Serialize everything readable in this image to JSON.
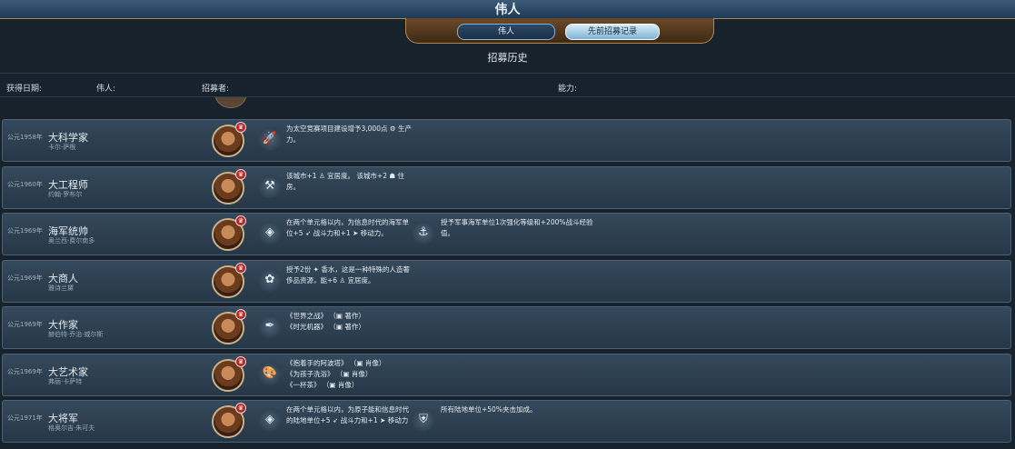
{
  "window": {
    "title": "伟人"
  },
  "tabs": [
    {
      "label": "伟人",
      "active": false
    },
    {
      "label": "先前招募记录",
      "active": true
    }
  ],
  "subtitle": "招募历史",
  "columns": {
    "date": "获得日期:",
    "person": "伟人:",
    "recruiter": "招募者:",
    "ability": "能力:"
  },
  "colors": {
    "accent_gold": "#a78b4e",
    "panel": "#2e4254",
    "badge": "#b22a2a"
  },
  "records": [
    {
      "date": "公元1958年",
      "type": "大科学家",
      "name": "卡尔·萨根",
      "abilities": [
        {
          "icon": "rocket-icon",
          "text": "为太空竞赛项目建设增予3,000点 ⚙ 生产力。"
        }
      ]
    },
    {
      "date": "公元1960年",
      "type": "大工程师",
      "name": "约翰·罗布尔",
      "abilities": [
        {
          "icon": "hammer-wrench-icon",
          "text": "该城市+1 ♙ 宜居度。 该城市+2 ☗ 住房。"
        }
      ]
    },
    {
      "date": "公元1969年",
      "type": "海军统帅",
      "name": "奥兰西·费尔南多",
      "abilities": [
        {
          "icon": "compass-icon",
          "text": "在两个单元格以内，为信息时代的海军单位+5 ➶ 战斗力和+1 ➤ 移动力。"
        },
        {
          "icon": "anchor-icon",
          "text": "授予军事海军单位1次强化等级和+200%战斗经验值。"
        }
      ]
    },
    {
      "date": "公元1969年",
      "type": "大商人",
      "name": "雅诗兰黛",
      "abilities": [
        {
          "icon": "perfume-icon",
          "text": "授予2份 ✦ 香水，这是一种特殊的人造奢侈品资源，能+6 ♙ 宜居度。"
        }
      ]
    },
    {
      "date": "公元1969年",
      "type": "大作家",
      "name": "赫伯特·乔治·威尔斯",
      "abilities": [
        {
          "icon": "quill-icon",
          "text": "《世界之战》 （▣ 著作）\n《时光机器》 （▣ 著作）"
        }
      ]
    },
    {
      "date": "公元1969年",
      "type": "大艺术家",
      "name": "弗丽·卡萨特",
      "abilities": [
        {
          "icon": "palette-icon",
          "text": "《抱着手的阿波塔》 （▣ 肖像）\n《为孩子洗浴》 （▣ 肖像）\n《一杯茶》 （▣ 肖像）"
        }
      ]
    },
    {
      "date": "公元1971年",
      "type": "大将军",
      "name": "格奥尔吉·朱可夫",
      "abilities": [
        {
          "icon": "compass-icon",
          "text": "在两个单元格以内，为原子能和信息时代的陆地单位+5 ➶ 战斗力和+1 ➤ 移动力"
        },
        {
          "icon": "shield-banner-icon",
          "text": "所有陆地单位+50%夹击加成。"
        }
      ]
    }
  ]
}
